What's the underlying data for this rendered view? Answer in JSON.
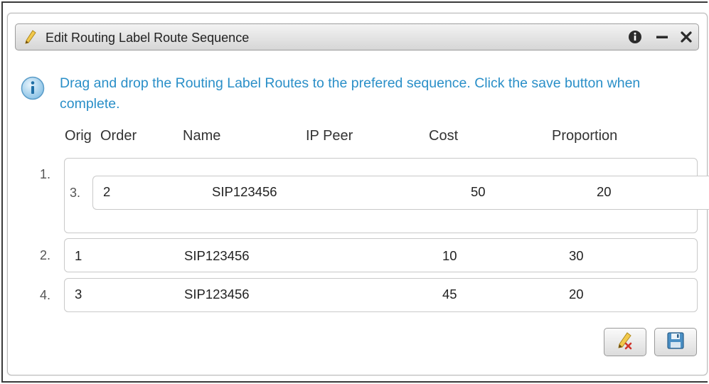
{
  "dialog": {
    "title": "Edit Routing Label Route Sequence",
    "icons": {
      "title_icon": "pencil-icon",
      "info_button": "info-icon",
      "minimize_button": "minimize-icon",
      "close_button": "close-icon"
    }
  },
  "message": {
    "icon": "info-icon",
    "text": "Drag and drop the Routing Label Routes to the prefered sequence. Click the save button when complete."
  },
  "columns": {
    "orig": "Orig",
    "order": "Order",
    "name": "Name",
    "ip_peer": "IP Peer",
    "cost": "Cost",
    "proportion": "Proportion"
  },
  "rows": [
    {
      "position": "1.",
      "orig": "3.",
      "order": "2",
      "name": "SIP123456",
      "ip_peer": "",
      "cost": "50",
      "proportion": "20"
    },
    {
      "position": "2.",
      "order": "1",
      "name": "SIP123456",
      "ip_peer": "",
      "cost": "10",
      "proportion": "30"
    },
    {
      "position": "4.",
      "order": "3",
      "name": "SIP123456",
      "ip_peer": "",
      "cost": "45",
      "proportion": "20"
    }
  ],
  "footer": {
    "reset_button_icon": "pencil-clear-icon",
    "save_button_icon": "floppy-disk-icon"
  },
  "colors": {
    "info_text": "#2a8fc8",
    "titlebar_top": "#f3f3f3",
    "titlebar_bottom": "#d6d6d6"
  }
}
